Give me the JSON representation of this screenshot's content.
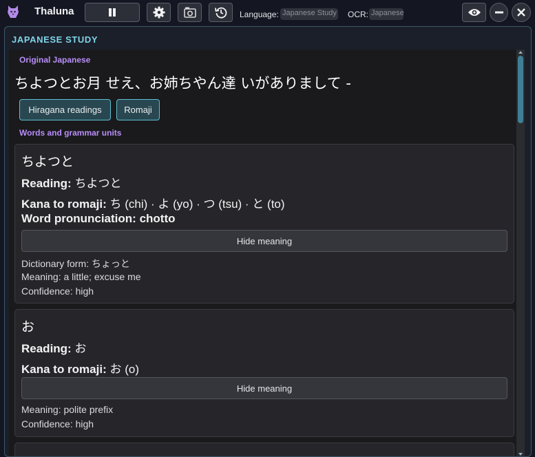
{
  "app": {
    "title": "Thaluna"
  },
  "toolbar": {
    "language_label": "Language:",
    "language_value": "Japanese Study",
    "ocr_label": "OCR:",
    "ocr_value": "Japanese",
    "icons": [
      "pause-icon",
      "gear-icon",
      "camera-icon",
      "history-icon",
      "eye-icon",
      "minimize-icon",
      "close-icon"
    ]
  },
  "panel": {
    "title": "JAPANESE STUDY",
    "original_label": "Original Japanese",
    "original_text": "ちよつとお月 せえ、お姉ちやん達 いがありまして -",
    "buttons": [
      "Hiragana readings",
      "Romaji"
    ],
    "words_label": "Words and grammar units"
  },
  "words": [
    {
      "word": "ちよつと",
      "reading_label": "Reading:",
      "reading": "ちよつと",
      "kana_label": "Kana to romaji:",
      "kana_romaji": "ち (chi) · よ (yo) · つ (tsu) · と (to)",
      "pron_label": "Word pronunciation:",
      "pronunciation": "chotto",
      "hide_label": "Hide meaning",
      "dictionary_form": "Dictionary form: ちょっと",
      "meaning": "Meaning: a little; excuse me",
      "confidence": "Confidence: high"
    },
    {
      "word": "お",
      "reading_label": "Reading:",
      "reading": "お",
      "kana_label": "Kana to romaji:",
      "kana_romaji": "お (o)",
      "hide_label": "Hide meaning",
      "meaning": "Meaning: polite prefix",
      "confidence": "Confidence: high"
    }
  ],
  "colors": {
    "accent_cyan": "#7fd4e8",
    "accent_purple": "#b88ef7",
    "background": "#141722"
  }
}
